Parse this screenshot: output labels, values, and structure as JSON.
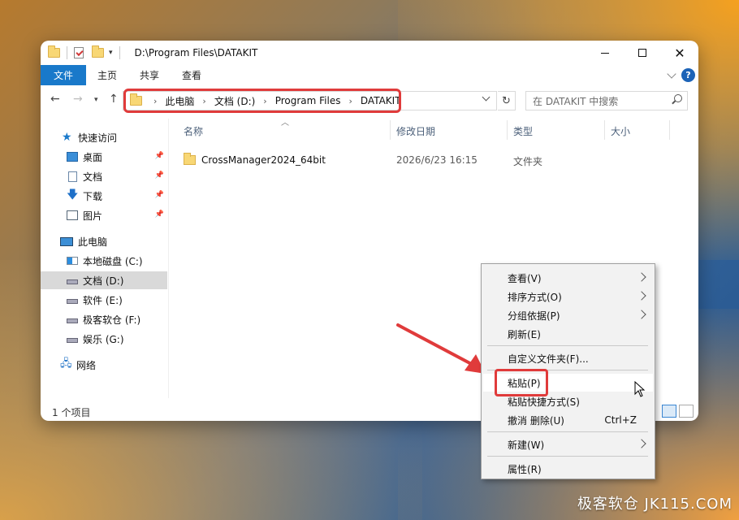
{
  "window": {
    "title": "D:\\Program Files\\DATAKIT"
  },
  "ribbon": {
    "tabs": [
      "文件",
      "主页",
      "共享",
      "查看"
    ]
  },
  "address_bar": {
    "crumbs": [
      "此电脑",
      "文档 (D:)",
      "Program Files",
      "DATAKIT"
    ],
    "search_placeholder": "在 DATAKIT 中搜索"
  },
  "sidebar": {
    "quick_access": "快速访问",
    "quick_items": [
      "桌面",
      "文档",
      "下载",
      "图片"
    ],
    "this_pc": "此电脑",
    "drives": [
      "本地磁盘 (C:)",
      "文档 (D:)",
      "软件 (E:)",
      "极客软仓 (F:)",
      "娱乐 (G:)"
    ],
    "network": "网络",
    "selected": "文档 (D:)"
  },
  "columns": {
    "name": "名称",
    "modified": "修改日期",
    "type": "类型",
    "size": "大小"
  },
  "files": [
    {
      "name": "CrossManager2024_64bit",
      "modified": "2026/6/23 16:15",
      "type": "文件夹",
      "size": ""
    }
  ],
  "status": {
    "item_count": "1 个项目"
  },
  "context_menu": {
    "view": "查看(V)",
    "sort": "排序方式(O)",
    "group": "分组依据(P)",
    "refresh": "刷新(E)",
    "customize": "自定义文件夹(F)...",
    "paste": "粘贴(P)",
    "paste_shortcut": "粘贴快捷方式(S)",
    "undo_delete": "撤消 删除(U)",
    "undo_shortcut": "Ctrl+Z",
    "new": "新建(W)",
    "properties": "属性(R)"
  },
  "watermark": "极客软仓 JK115.COM",
  "colors": {
    "accent": "#1979ca",
    "highlight": "#e03b3b"
  }
}
